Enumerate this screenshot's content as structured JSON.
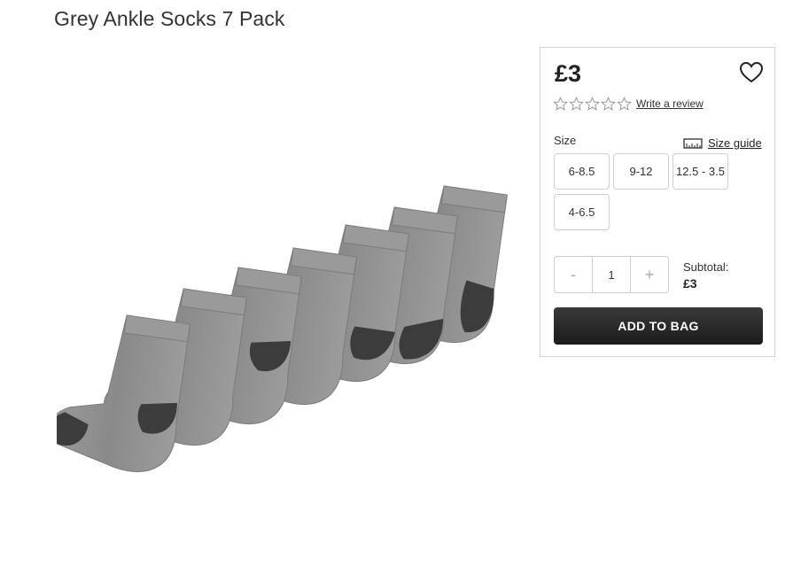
{
  "product": {
    "title": "Grey Ankle Socks 7 Pack",
    "price": "£3",
    "image_alt": "grey-ankle-socks-photo"
  },
  "rating": {
    "stars": 0,
    "max_stars": 5,
    "write_review": "Write a review"
  },
  "size": {
    "label": "Size",
    "guide_label": "Size guide",
    "options": [
      "6-8.5",
      "9-12",
      "12.5 - 3.5",
      "4-6.5"
    ]
  },
  "quantity": {
    "minus": "-",
    "value": "1",
    "plus": "+"
  },
  "subtotal": {
    "label": "Subtotal:",
    "value": "£3"
  },
  "actions": {
    "add_to_bag": "ADD TO BAG"
  },
  "icons": {
    "wishlist": "heart-icon",
    "rating": "star-outline-icon",
    "size_guide": "ruler-icon"
  },
  "colors": {
    "sock_grey": "#8f8f8f",
    "sock_dark": "#3c3c3c",
    "button_dark": "#222222"
  }
}
